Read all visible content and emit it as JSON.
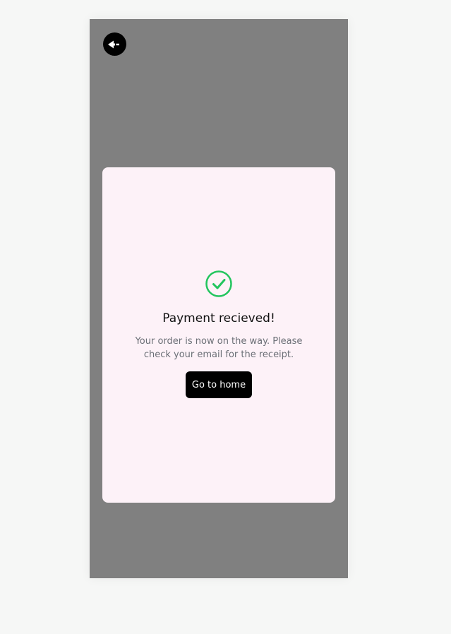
{
  "header": {
    "back_icon": "back-arrow-icon"
  },
  "dialog": {
    "icon": "check-circle-icon",
    "icon_color": "#22c55e",
    "title": "Payment recieved!",
    "message": "Your order is now on the way. Please check your email for the receipt.",
    "button_label": "Go to home",
    "background_color": "#fdf2f8"
  },
  "colors": {
    "overlay": "#808080",
    "page_background": "#f6f7f6",
    "button_background": "#000000"
  }
}
